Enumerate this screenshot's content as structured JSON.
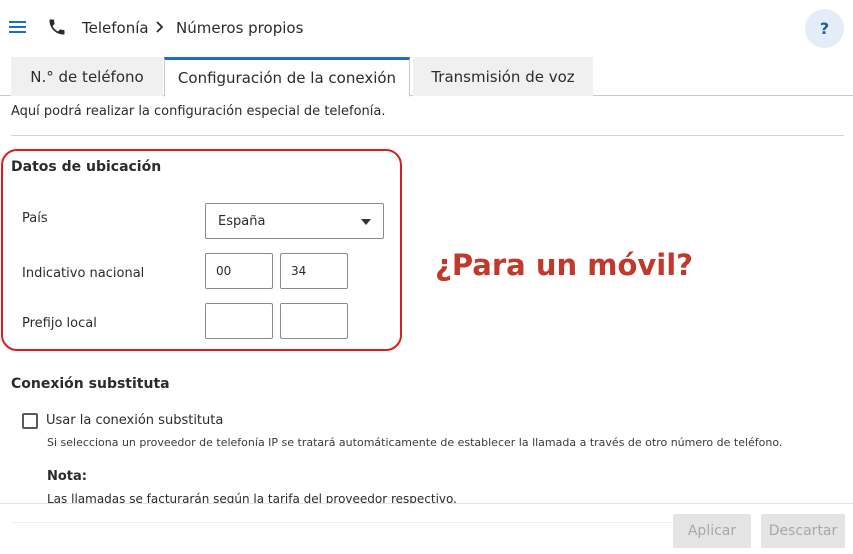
{
  "header": {
    "breadcrumb_root": "Telefonía",
    "breadcrumb_current": "Números propios",
    "help_label": "?"
  },
  "tabs": [
    {
      "label": "N.° de teléfono",
      "active": false
    },
    {
      "label": "Configuración de la conexión",
      "active": true
    },
    {
      "label": "Transmisión de voz",
      "active": false
    }
  ],
  "intro": "Aquí podrá realizar la configuración especial de telefonía.",
  "location": {
    "title": "Datos de ubicación",
    "country_label": "País",
    "country_value": "España",
    "national_code_label": "Indicativo nacional",
    "national_code_1": "00",
    "national_code_2": "34",
    "local_prefix_label": "Prefijo local",
    "local_prefix_1": "",
    "local_prefix_2": ""
  },
  "annotation": "¿Para un móvil?",
  "substitute": {
    "title": "Conexión substituta",
    "checkbox_label": "Usar la conexión substituta",
    "checked": false,
    "help": "Si selecciona un proveedor de telefonía IP se tratará automáticamente de establecer la llamada a través de otro número de teléfono.",
    "note_title": "Nota:",
    "note_text": "Las llamadas se facturarán según la tarifa del proveedor respectivo."
  },
  "footer": {
    "apply_label": "Aplicar",
    "discard_label": "Descartar"
  },
  "colors": {
    "accent": "#1a6fc4",
    "annotation": "#c0392b",
    "frame": "#d81e1e"
  }
}
